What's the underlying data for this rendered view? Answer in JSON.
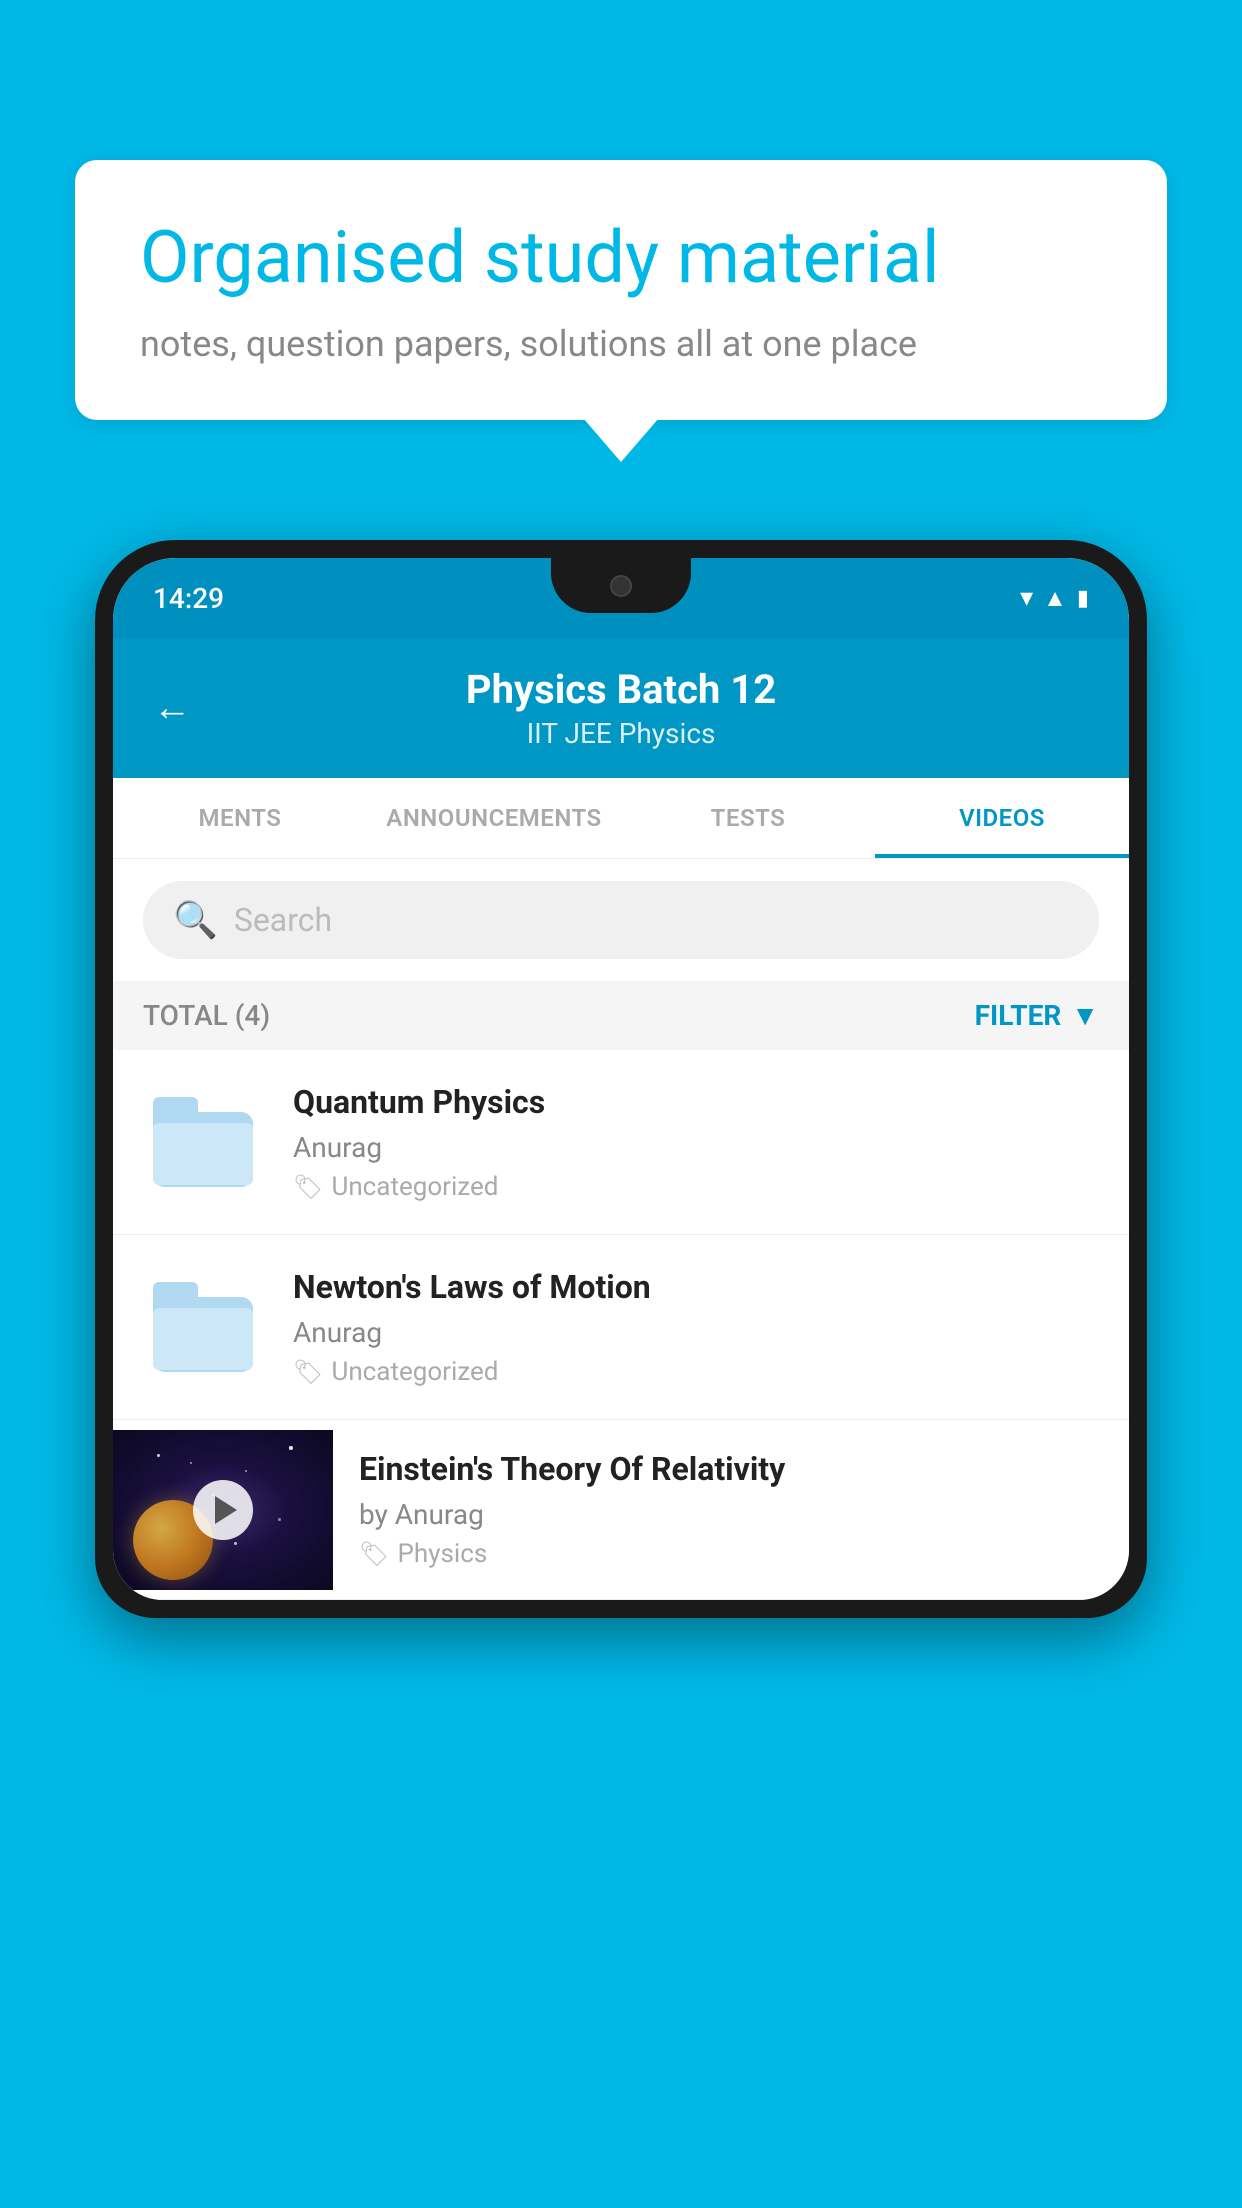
{
  "background_color": "#00b8e6",
  "info_card": {
    "title": "Organised study material",
    "subtitle": "notes, question papers, solutions all at one place"
  },
  "phone": {
    "status_bar": {
      "time": "14:29"
    },
    "header": {
      "title": "Physics Batch 12",
      "subtitle": "IIT JEE   Physics",
      "back_label": "←"
    },
    "tabs": [
      {
        "label": "MENTS",
        "active": false
      },
      {
        "label": "ANNOUNCEMENTS",
        "active": false
      },
      {
        "label": "TESTS",
        "active": false
      },
      {
        "label": "VIDEOS",
        "active": true
      }
    ],
    "search": {
      "placeholder": "Search"
    },
    "filter": {
      "total_label": "TOTAL (4)",
      "filter_label": "FILTER"
    },
    "videos": [
      {
        "title": "Quantum Physics",
        "author": "Anurag",
        "tag": "Uncategorized",
        "type": "folder"
      },
      {
        "title": "Newton's Laws of Motion",
        "author": "Anurag",
        "tag": "Uncategorized",
        "type": "folder"
      },
      {
        "title": "Einstein's Theory Of Relativity",
        "author": "by Anurag",
        "tag": "Physics",
        "type": "video"
      }
    ]
  }
}
